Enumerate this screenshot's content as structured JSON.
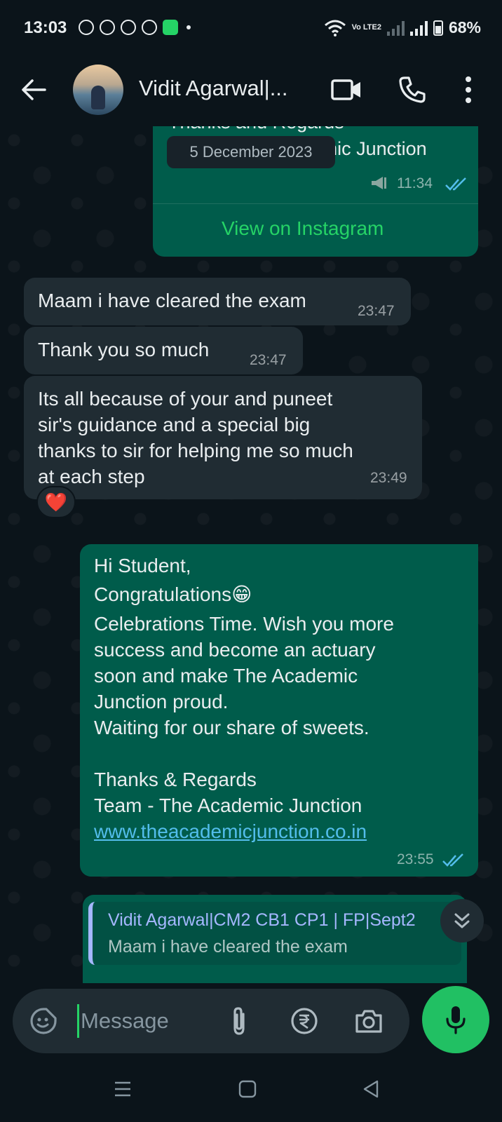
{
  "status_bar": {
    "time": "13:03",
    "network": "Vo LTE2",
    "battery": "68%"
  },
  "header": {
    "contact_name": "Vidit Agarwal|...",
    "icons": [
      "back-arrow-icon",
      "video-call-icon",
      "voice-call-icon",
      "more-options-icon"
    ]
  },
  "chat": {
    "date_chip": "5 December 2023",
    "top_card": {
      "partial_text_1": "Thanks and Regards",
      "partial_text_2": "Team - The Academic Junction",
      "time": "11:34",
      "link_label": "View on Instagram"
    },
    "messages": [
      {
        "dir": "in",
        "text": "Maam i have cleared the exam",
        "time": "23:47"
      },
      {
        "dir": "in",
        "text": "Thank you so much",
        "time": "23:47"
      },
      {
        "dir": "in",
        "lines": [
          "Its all because of your and puneet",
          "sir's guidance and a special big",
          "thanks to sir for helping me so much",
          "at each step"
        ],
        "time": "23:49",
        "reaction": "❤️"
      },
      {
        "dir": "out",
        "lines": [
          "Hi Student,",
          "Congratulations😁",
          "Celebrations Time. Wish you more",
          "success and become an actuary",
          "soon and make The Academic",
          "Junction proud.",
          "Waiting for our share of sweets.",
          "",
          "Thanks & Regards",
          "Team - The Academic Junction"
        ],
        "link": "www.theacademicjunction.co.in",
        "time": "23:55"
      }
    ],
    "reply": {
      "quoted_name": "Vidit Agarwal|CM2 CB1 CP1  | FP|Sept2",
      "quoted_text": "Maam i have cleared the exam"
    }
  },
  "input": {
    "placeholder": "Message"
  },
  "colors": {
    "background": "#0b141a",
    "incoming_bubble": "#202c33",
    "outgoing_bubble": "#005c4b",
    "accent": "#25d366",
    "link": "#53bdeb",
    "read_tick": "#53bdeb"
  }
}
